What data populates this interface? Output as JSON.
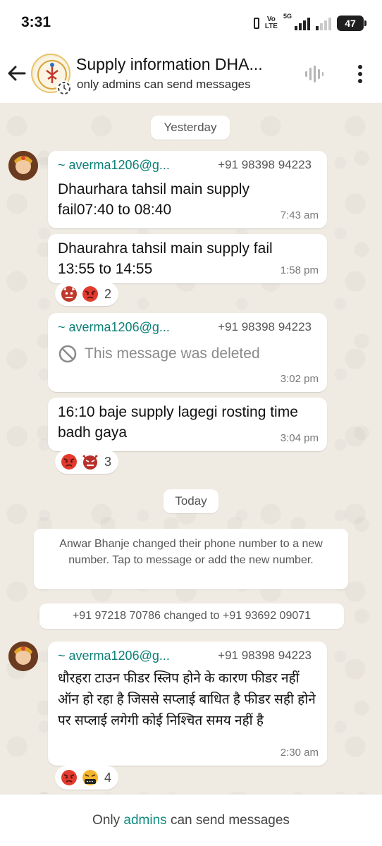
{
  "status_bar": {
    "time": "3:31",
    "volte_line1": "Vo",
    "volte_line2": "LTE",
    "network": "5G",
    "battery": "47"
  },
  "header": {
    "title": "Supply information DHA...",
    "subtitle": "only admins can send messages"
  },
  "dates": {
    "yesterday": "Yesterday",
    "today": "Today"
  },
  "messages": [
    {
      "sender": "~ averma1206@g...",
      "phone": "+91 98398 94223",
      "text": "Dhaurhara tahsil main supply fail07:40 to 08:40",
      "time": "7:43 am"
    },
    {
      "text": "Dhaurahra tahsil main supply fail 13:55 to 14:55",
      "time": "1:58 pm",
      "reaction_count": "2"
    },
    {
      "sender": "~ averma1206@g...",
      "phone": "+91 98398 94223",
      "text": "This message was deleted",
      "time": "3:02 pm"
    },
    {
      "text": "16:10 baje supply lagegi rosting time badh gaya",
      "time": "3:04 pm",
      "reaction_count": "3"
    },
    {
      "sender": "~ averma1206@g...",
      "phone": "+91 98398 94223",
      "text": "धौरहरा टाउन फीडर स्लिप होने के कारण फीडर नहीं ऑन हो रहा है जिससे सप्लाई बाधित है फीडर सही होने पर सप्लाई लगेगी कोई निश्चित समय नहीं है",
      "time": "2:30 am",
      "reaction_count": "4"
    }
  ],
  "system_messages": {
    "number_change_notice": "Anwar Bhanje changed their phone number to a new number. Tap to message or add the new number.",
    "number_change": "+91 97218 70786 changed to +91 93692 09071"
  },
  "footer": {
    "prefix": "Only",
    "link": "admins",
    "suffix": "can send messages"
  },
  "colors": {
    "sender_name": "#0b7f76",
    "chat_background": "#efeae2",
    "admin_link": "#128c7e"
  }
}
